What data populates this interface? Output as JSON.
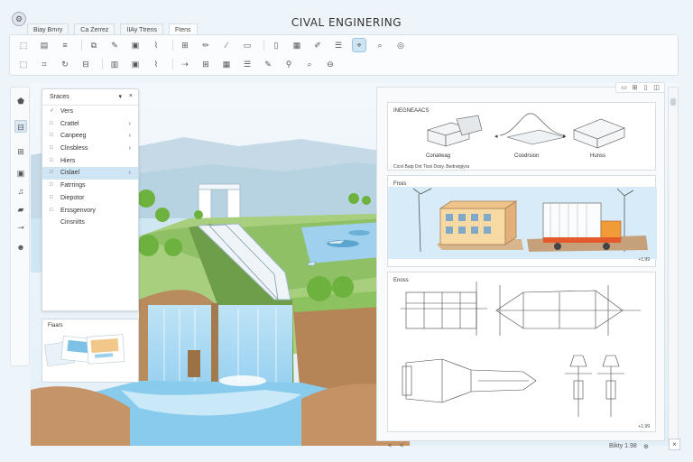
{
  "app": {
    "title": "CIVAL ENGINERING",
    "icon": "app-logo-icon"
  },
  "tabs": [
    {
      "label": "Biay  Brnry",
      "active": false
    },
    {
      "label": "Ca Zerrez",
      "active": false
    },
    {
      "label": "IIAy Ttrens",
      "active": false
    },
    {
      "label": "Ftens",
      "active": true
    }
  ],
  "toolbar": {
    "row1": [
      "select-icon",
      "page-icon",
      "text-icon",
      "sep",
      "stack-icon",
      "pen-icon",
      "image-icon",
      "brush-icon",
      "sep",
      "grid-icon",
      "pencil-icon",
      "line-icon",
      "rect-icon",
      "sep",
      "doc-icon",
      "table-icon",
      "edit-icon",
      "list-icon",
      "cursor-icon",
      "zoom-icon",
      "target-icon"
    ],
    "row2": [
      "select-icon",
      "crop-icon",
      "rotate-icon",
      "layers-icon",
      "sep",
      "bar-icon",
      "image-icon",
      "brush-icon",
      "sep",
      "arrow-icon",
      "grid-icon",
      "table-icon",
      "list-icon",
      "pen-icon",
      "pin-icon",
      "zoom-icon",
      "zoom-out-icon"
    ],
    "active_tool": "cursor-icon"
  },
  "rail": [
    "home-icon",
    "layers-icon",
    "grid-icon",
    "image-icon",
    "music-icon",
    "folder-icon",
    "link-icon",
    "user-icon"
  ],
  "layers_panel": {
    "title": "Sraces",
    "items": [
      {
        "label": "Vers",
        "icon": "✓",
        "arrow": ""
      },
      {
        "label": "Crattel",
        "icon": "□",
        "arrow": "›"
      },
      {
        "label": "Canpeeg",
        "icon": "□",
        "arrow": "›"
      },
      {
        "label": "Clnsbless",
        "icon": "□",
        "arrow": "›"
      },
      {
        "label": "Hiers",
        "icon": "□",
        "arrow": ""
      },
      {
        "label": "Cislael",
        "icon": "□",
        "arrow": "›",
        "selected": true
      },
      {
        "label": "Fatrrings",
        "icon": "□",
        "arrow": ""
      },
      {
        "label": "Diepotor",
        "icon": "□",
        "arrow": ""
      },
      {
        "label": "Erssgenvory",
        "icon": "□",
        "arrow": ""
      },
      {
        "label": "Cinsnitts",
        "icon": "",
        "arrow": ""
      }
    ]
  },
  "photos_panel": {
    "title": "Fiaars"
  },
  "view_controls": [
    "▭",
    "⊞",
    "▯",
    "◫"
  ],
  "cards": {
    "engineering": {
      "title": "INEGNEAACS",
      "fig1": "Conatwag",
      "fig2": "Coodrsion",
      "fig3": "Hunss",
      "footer": "Cicst Baip Dot Tissi Dosy. Bedrargiyra"
    },
    "buildings": {
      "title": "Fnsis",
      "footer": "+1.99"
    },
    "blueprints": {
      "title": "Enoss",
      "footer": "+1.99"
    }
  },
  "bottom_bar": {
    "nav_prev": "<",
    "nav_next": "<",
    "zoom": "Bikty 1.98",
    "expand": "×"
  },
  "colors": {
    "accent": "#cfe5f3",
    "sky": "#eaf3fa",
    "water": "#86c6ea",
    "grass": "#7fb85a",
    "earth": "#b98c5e"
  }
}
